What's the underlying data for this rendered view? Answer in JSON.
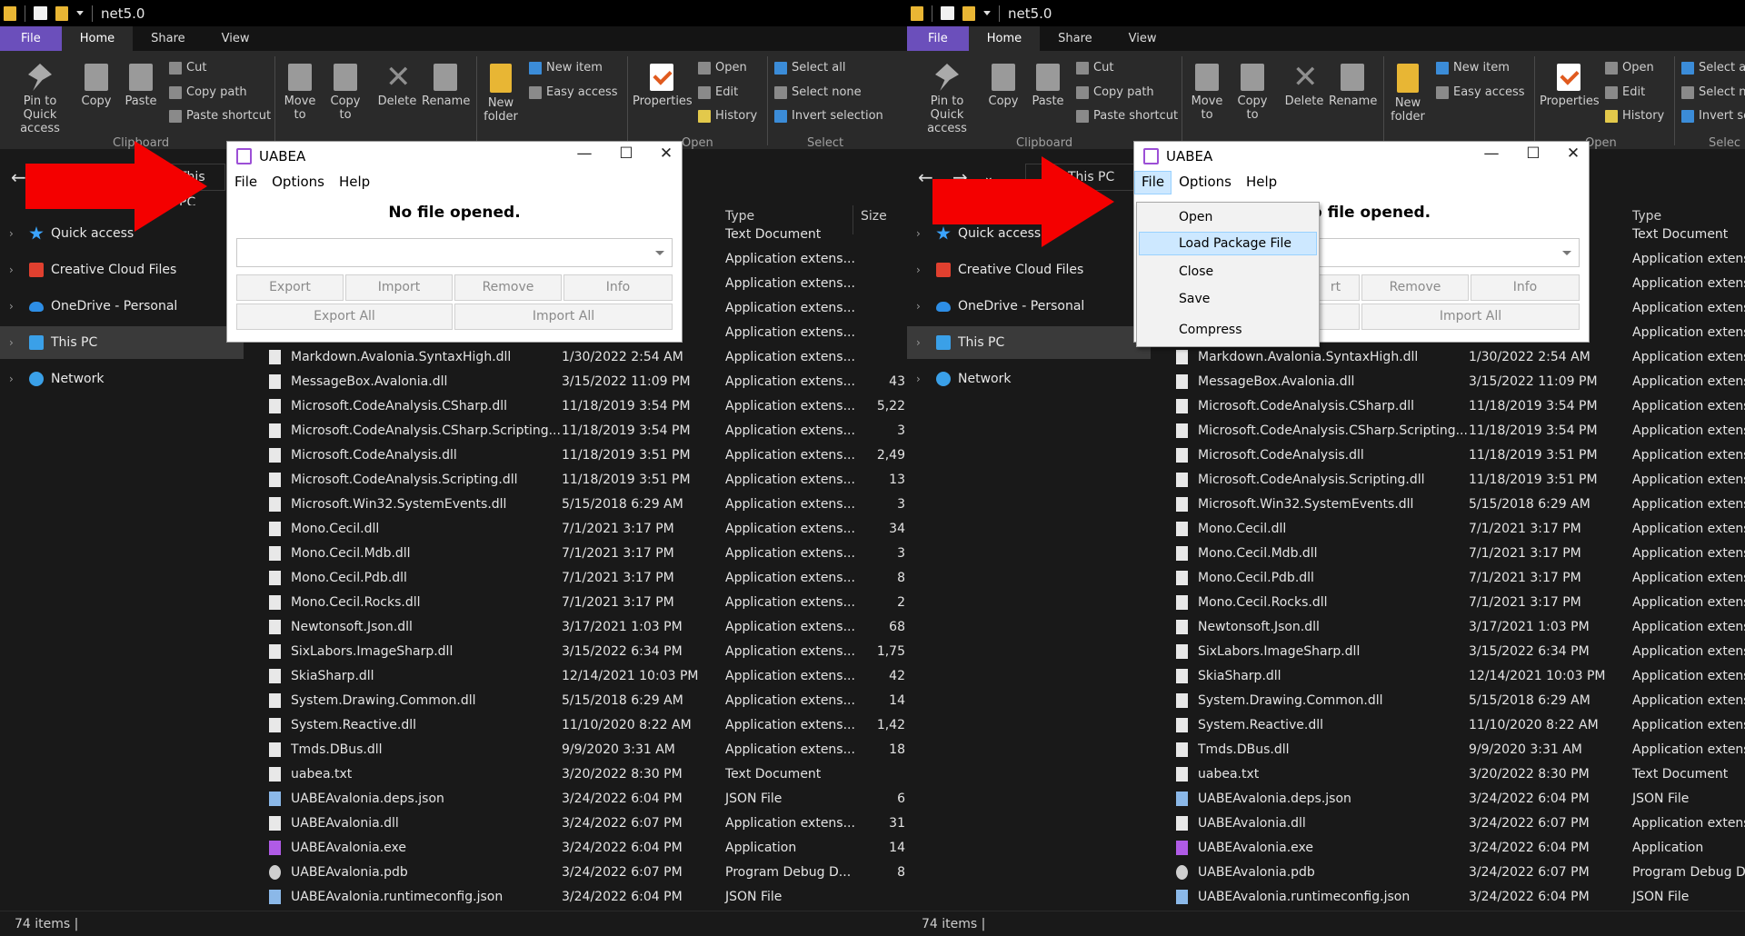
{
  "explorer": {
    "window_title": "net5.0",
    "tabs": [
      "File",
      "Home",
      "Share",
      "View"
    ],
    "ribbon": {
      "pin": "Pin to Quick access",
      "copy": "Copy",
      "paste": "Paste",
      "cut": "Cut",
      "copy_path": "Copy path",
      "paste_shortcut": "Paste shortcut",
      "move_to": "Move to",
      "copy_to": "Copy to",
      "delete": "Delete",
      "rename": "Rename",
      "new_folder": "New folder",
      "new_item": "New item",
      "easy_access": "Easy access",
      "properties": "Properties",
      "open": "Open",
      "edit": "Edit",
      "history": "History",
      "select_all": "Select all",
      "select_none": "Select none",
      "invert_selection": "Invert selection",
      "groups": {
        "clipboard": "Clipboard",
        "open": "Open",
        "select": "Select"
      }
    },
    "address": "This PC",
    "nav": [
      {
        "label": "Quick access",
        "icon": "star-icon"
      },
      {
        "label": "Creative Cloud Files",
        "icon": "creative-cloud-icon"
      },
      {
        "label": "OneDrive - Personal",
        "icon": "cloud-icon"
      },
      {
        "label": "This PC",
        "icon": "computer-icon"
      },
      {
        "label": "Network",
        "icon": "network-icon"
      }
    ],
    "columns": {
      "type": "Type",
      "size": "Size"
    },
    "partial_rows": [
      {
        "type": "Text Document"
      },
      {
        "type": "Application extens..."
      },
      {
        "type": "Application extens..."
      },
      {
        "type": "Application extens..."
      },
      {
        "type": "Application extens..."
      }
    ],
    "files": [
      {
        "name": "Markdown.Avalonia.SyntaxHigh.dll",
        "date": "1/30/2022 2:54 AM",
        "type": "Application extens...",
        "size": "",
        "icon": "dll"
      },
      {
        "name": "MessageBox.Avalonia.dll",
        "date": "3/15/2022 11:09 PM",
        "type": "Application extens...",
        "size": "43",
        "icon": "dll"
      },
      {
        "name": "Microsoft.CodeAnalysis.CSharp.dll",
        "date": "11/18/2019 3:54 PM",
        "type": "Application extens...",
        "size": "5,22",
        "icon": "dll"
      },
      {
        "name": "Microsoft.CodeAnalysis.CSharp.Scripting...",
        "date": "11/18/2019 3:54 PM",
        "type": "Application extens...",
        "size": "3",
        "icon": "dll"
      },
      {
        "name": "Microsoft.CodeAnalysis.dll",
        "date": "11/18/2019 3:51 PM",
        "type": "Application extens...",
        "size": "2,49",
        "icon": "dll"
      },
      {
        "name": "Microsoft.CodeAnalysis.Scripting.dll",
        "date": "11/18/2019 3:51 PM",
        "type": "Application extens...",
        "size": "13",
        "icon": "dll"
      },
      {
        "name": "Microsoft.Win32.SystemEvents.dll",
        "date": "5/15/2018 6:29 AM",
        "type": "Application extens...",
        "size": "3",
        "icon": "dll"
      },
      {
        "name": "Mono.Cecil.dll",
        "date": "7/1/2021 3:17 PM",
        "type": "Application extens...",
        "size": "34",
        "icon": "dll"
      },
      {
        "name": "Mono.Cecil.Mdb.dll",
        "date": "7/1/2021 3:17 PM",
        "type": "Application extens...",
        "size": "3",
        "icon": "dll"
      },
      {
        "name": "Mono.Cecil.Pdb.dll",
        "date": "7/1/2021 3:17 PM",
        "type": "Application extens...",
        "size": "8",
        "icon": "dll"
      },
      {
        "name": "Mono.Cecil.Rocks.dll",
        "date": "7/1/2021 3:17 PM",
        "type": "Application extens...",
        "size": "2",
        "icon": "dll"
      },
      {
        "name": "Newtonsoft.Json.dll",
        "date": "3/17/2021 1:03 PM",
        "type": "Application extens...",
        "size": "68",
        "icon": "dll"
      },
      {
        "name": "SixLabors.ImageSharp.dll",
        "date": "3/15/2022 6:34 PM",
        "type": "Application extens...",
        "size": "1,75",
        "icon": "dll"
      },
      {
        "name": "SkiaSharp.dll",
        "date": "12/14/2021 10:03 PM",
        "type": "Application extens...",
        "size": "42",
        "icon": "dll"
      },
      {
        "name": "System.Drawing.Common.dll",
        "date": "5/15/2018 6:29 AM",
        "type": "Application extens...",
        "size": "14",
        "icon": "dll"
      },
      {
        "name": "System.Reactive.dll",
        "date": "11/10/2020 8:22 AM",
        "type": "Application extens...",
        "size": "1,42",
        "icon": "dll"
      },
      {
        "name": "Tmds.DBus.dll",
        "date": "9/9/2020 3:31 AM",
        "type": "Application extens...",
        "size": "18",
        "icon": "dll"
      },
      {
        "name": "uabea.txt",
        "date": "3/20/2022 8:30 PM",
        "type": "Text Document",
        "size": "",
        "icon": "txt"
      },
      {
        "name": "UABEAvalonia.deps.json",
        "date": "3/24/2022 6:04 PM",
        "type": "JSON File",
        "size": "6",
        "icon": "json"
      },
      {
        "name": "UABEAvalonia.dll",
        "date": "3/24/2022 6:07 PM",
        "type": "Application extens...",
        "size": "31",
        "icon": "dll"
      },
      {
        "name": "UABEAvalonia.exe",
        "date": "3/24/2022 6:04 PM",
        "type": "Application",
        "size": "14",
        "icon": "exe"
      },
      {
        "name": "UABEAvalonia.pdb",
        "date": "3/24/2022 6:07 PM",
        "type": "Program Debug D...",
        "size": "8",
        "icon": "pdb"
      },
      {
        "name": "UABEAvalonia.runtimeconfig.json",
        "date": "3/24/2022 6:04 PM",
        "type": "JSON File",
        "size": "",
        "icon": "json"
      }
    ],
    "status": "74 items"
  },
  "right_types": [
    "Application extens",
    "Application extens",
    "Application extens",
    "Application extens",
    "Application extens",
    "Application extens",
    "Application extens",
    "Application extens",
    "Application extens",
    "Application extens",
    "Application extens",
    "Application extens",
    "Application extens",
    "Application extens",
    "Application extens",
    "Application extens",
    "Application extens",
    "Text Document",
    "JSON File",
    "Application extens",
    "Application",
    "Program Debug D",
    "JSON File"
  ],
  "right_partial_types": [
    "Text Document",
    "Application extens",
    "Application extens",
    "Application extens",
    "Application extens"
  ],
  "right_ribbon": {
    "select_all": "Select al",
    "select_none": "Select n",
    "invert": "Invert se",
    "select_group": "Selec"
  },
  "uabea": {
    "title": "UABEA",
    "menu": [
      "File",
      "Options",
      "Help"
    ],
    "no_file": "No file opened.",
    "no_file_partial": "o file opened.",
    "buttons": {
      "export": "Export",
      "import": "Import",
      "remove": "Remove",
      "info": "Info",
      "export_all": "Export All",
      "import_all": "Import All",
      "import_partial": "rt"
    },
    "file_menu": [
      "Open",
      "Load Package File",
      "Close",
      "Save",
      "Compress"
    ],
    "file_menu_highlighted": "Load Package File"
  },
  "colors": {
    "arrow": "#f40000",
    "file_tab": "#6b4fbb",
    "menu_highlight": "#cde8ff"
  }
}
